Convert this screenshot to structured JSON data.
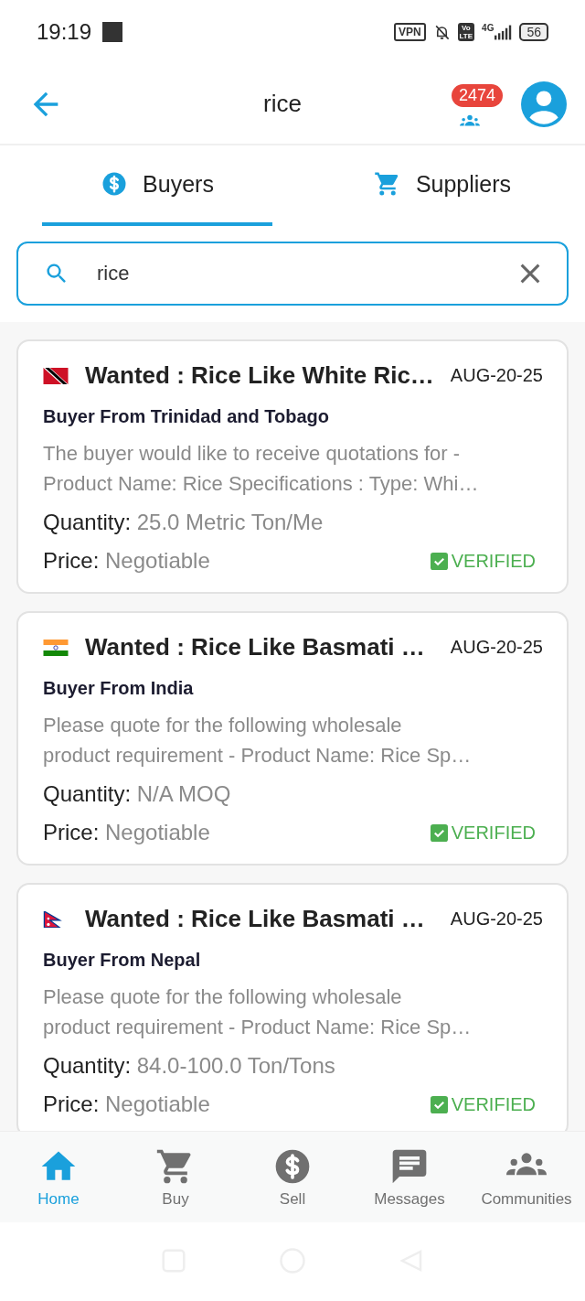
{
  "status_bar": {
    "time": "19:19",
    "vpn": "VPN",
    "volte": [
      "Vo",
      "LTE"
    ],
    "network": "4G",
    "battery": "56"
  },
  "app_bar": {
    "title": "rice",
    "badge": "2474"
  },
  "tabs": [
    {
      "label": "Buyers",
      "kind": "dollar",
      "selected": true
    },
    {
      "label": "Suppliers",
      "kind": "cart",
      "selected": false
    }
  ],
  "search": {
    "value": "rice"
  },
  "listings": [
    {
      "kind": "trinidad",
      "title": "Wanted : Rice Like White Ric…",
      "date": "AUG-20-25",
      "buyer": "Buyer From Trinidad and Tobago",
      "description": [
        "The buyer would like to receive quotations for -",
        "Product Name: Rice Specifications : Type: Whi…"
      ],
      "quantity_label": "Quantity:",
      "quantity": "25.0 Metric Ton/Me",
      "price_label": "Price:",
      "price": "Negotiable",
      "verified": true,
      "verified_label": "VERIFIED"
    },
    {
      "kind": "india",
      "title": "Wanted : Rice Like Basmati …",
      "date": "AUG-20-25",
      "buyer": "Buyer From India",
      "description": [
        "Please quote for the following wholesale",
        "product requirement - Product Name: Rice Sp…"
      ],
      "quantity_label": "Quantity:",
      "quantity": "N/A MOQ",
      "price_label": "Price:",
      "price": "Negotiable",
      "verified": true,
      "verified_label": "VERIFIED"
    },
    {
      "kind": "nepal",
      "title": "Wanted : Rice Like Basmati …",
      "date": "AUG-20-25",
      "buyer": "Buyer From Nepal",
      "description": [
        "Please quote for the following wholesale",
        "product requirement - Product Name: Rice Sp…"
      ],
      "quantity_label": "Quantity:",
      "quantity": "84.0-100.0 Ton/Tons",
      "price_label": "Price:",
      "price": "Negotiable",
      "verified": true,
      "verified_label": "VERIFIED"
    }
  ],
  "bottom_nav": [
    {
      "label": "Home",
      "kind": "home",
      "selected": true
    },
    {
      "label": "Buy",
      "kind": "cart",
      "selected": false
    },
    {
      "label": "Sell",
      "kind": "dollar",
      "selected": false
    },
    {
      "label": "Messages",
      "kind": "message",
      "selected": false
    },
    {
      "label": "Communities",
      "kind": "people",
      "selected": false
    }
  ]
}
